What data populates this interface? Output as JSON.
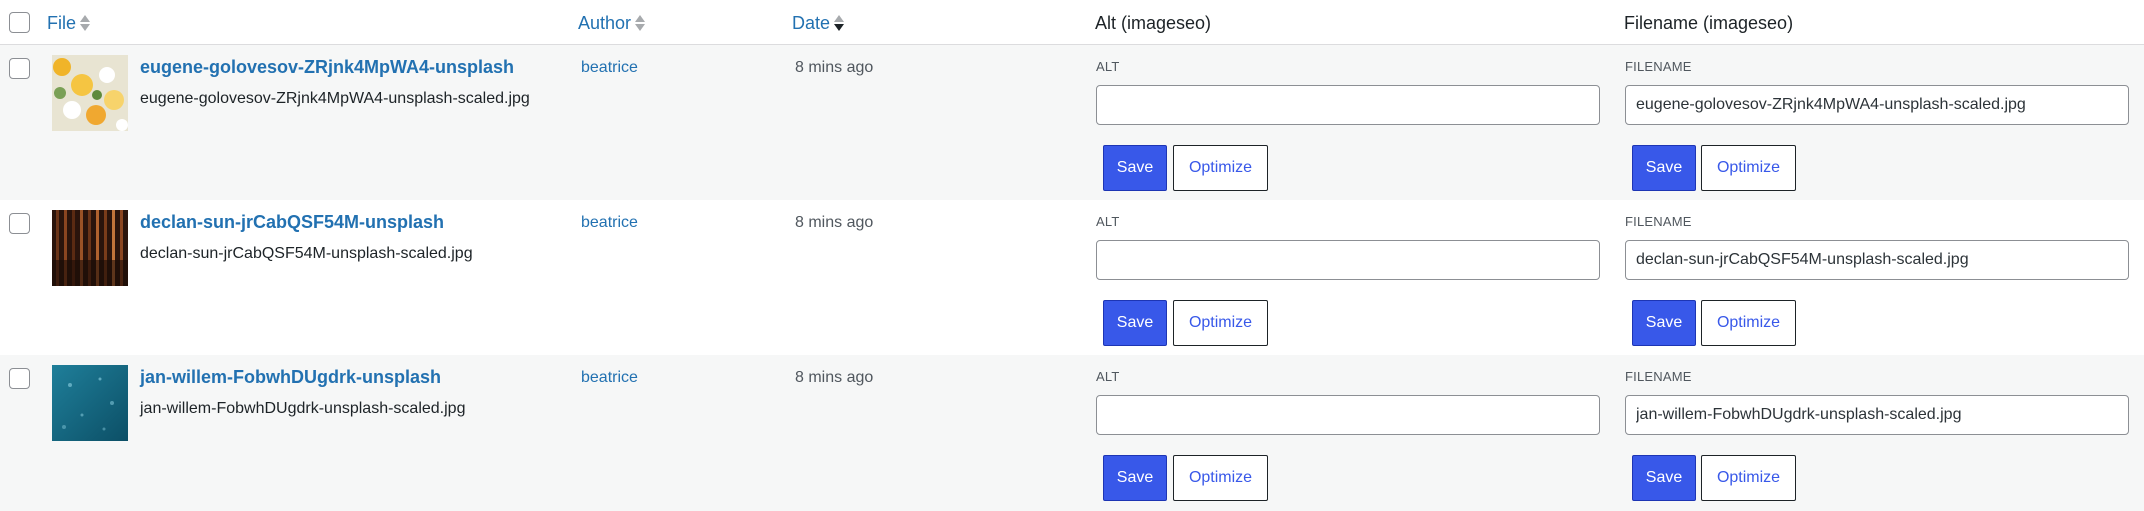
{
  "table": {
    "columns": {
      "file": "File",
      "author": "Author",
      "date": "Date",
      "alt": "Alt (imageseo)",
      "filename": "Filename (imageseo)"
    },
    "rows": [
      {
        "title": "eugene-golovesov-ZRjnk4MpWA4-unsplash",
        "file": "eugene-golovesov-ZRjnk4MpWA4-unsplash-scaled.jpg",
        "author": "beatrice",
        "date": "8 mins ago",
        "alt_label": "ALT",
        "alt_value": "",
        "filename_label": "FILENAME",
        "filename_value": "eugene-golovesov-ZRjnk4MpWA4-unsplash-scaled.jpg",
        "save_label": "Save",
        "optimize_label": "Optimize"
      },
      {
        "title": "declan-sun-jrCabQSF54M-unsplash",
        "file": "declan-sun-jrCabQSF54M-unsplash-scaled.jpg",
        "author": "beatrice",
        "date": "8 mins ago",
        "alt_label": "ALT",
        "alt_value": "",
        "filename_label": "FILENAME",
        "filename_value": "declan-sun-jrCabQSF54M-unsplash-scaled.jpg",
        "save_label": "Save",
        "optimize_label": "Optimize"
      },
      {
        "title": "jan-willem-FobwhDUgdrk-unsplash",
        "file": "jan-willem-FobwhDUgdrk-unsplash-scaled.jpg",
        "author": "beatrice",
        "date": "8 mins ago",
        "alt_label": "ALT",
        "alt_value": "",
        "filename_label": "FILENAME",
        "filename_value": "jan-willem-FobwhDUgdrk-unsplash-scaled.jpg",
        "save_label": "Save",
        "optimize_label": "Optimize"
      }
    ]
  },
  "colors": {
    "link": "#2271b1",
    "primary_button": "#3858e9",
    "alt_row_bg": "#f6f7f7"
  },
  "icons": {
    "file_sort": "sort-both-icon",
    "author_sort": "sort-both-icon",
    "date_sort": "sort-desc-icon"
  }
}
